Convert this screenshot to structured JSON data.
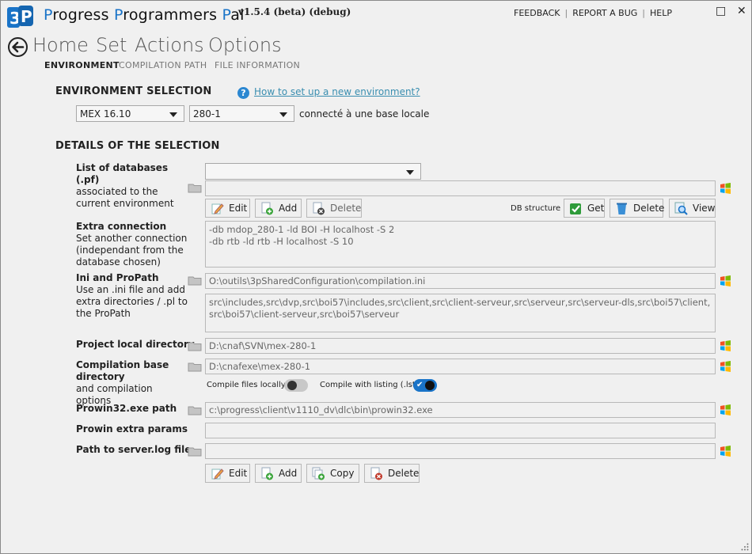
{
  "app": {
    "title_parts": [
      "P",
      "rogress ",
      "P",
      "rogrammers ",
      "P",
      "al"
    ],
    "version": "v1.5.4 (beta) (debug)",
    "links": [
      "FEEDBACK",
      "REPORT A BUG",
      "HELP"
    ],
    "maximize_glyph": "□",
    "close_glyph": "✕"
  },
  "nav": {
    "items": [
      "Home",
      "Set",
      "Actions",
      "Options"
    ],
    "subtabs": [
      "ENVIRONMENT",
      "COMPILATION PATH",
      "FILE INFORMATION"
    ]
  },
  "env": {
    "heading": "ENVIRONMENT SELECTION",
    "help_link": "How to set up a new environment?",
    "env_select": "MEX 16.10",
    "suffix_select": "280-1",
    "status": "connecté à une base locale"
  },
  "details": {
    "heading": "DETAILS OF THE SELECTION",
    "databases": {
      "title": "List of databases (.pf)",
      "desc": "associated to the current environment",
      "select_value": "",
      "path_value": ""
    },
    "db_buttons": [
      "Edit",
      "Add",
      "Delete"
    ],
    "db_structure_label": "DB structure :",
    "db_struct_buttons": [
      "Get",
      "Delete",
      "View"
    ],
    "extra_conn": {
      "title": "Extra connection",
      "desc": "Set another connection (independant from the database chosen)",
      "lines": [
        "-db mdop_280-1 -ld BOI -H localhost -S 2",
        "-db rtb -ld rtb -H localhost -S 10"
      ]
    },
    "ini": {
      "title": "Ini and ProPath",
      "desc": "Use an .ini file and add extra directories / .pl to the ProPath",
      "ini_path": "O:\\outils\\3pSharedConfiguration\\compilation.ini",
      "propath": "src\\includes,src\\dvp,src\\boi57\\includes,src\\client,src\\client-serveur,src\\serveur,src\\serveur-dls,src\\boi57\\client,src\\boi57\\client-serveur,src\\boi57\\serveur"
    },
    "project_dir": {
      "title": "Project local directory",
      "value": "D:\\cnaf\\SVN\\mex-280-1"
    },
    "compile_base": {
      "title": "Compilation base directory",
      "desc": "and compilation options",
      "value": "D:\\cnafexe\\mex-280-1",
      "opt_local": "Compile files locally?",
      "opt_listing": "Compile with listing (.lst)?",
      "local_on": false,
      "listing_on": true
    },
    "prowin": {
      "title": "Prowin32.exe path",
      "value": "c:\\progress\\client\\v1110_dv\\dlc\\bin\\prowin32.exe"
    },
    "prowin_params": {
      "title": "Prowin extra params",
      "value": ""
    },
    "server_log": {
      "title": "Path to server.log file",
      "value": ""
    },
    "env_buttons": [
      "Edit",
      "Add",
      "Copy",
      "Delete"
    ]
  },
  "colors": {
    "accent": "#1a74c8",
    "link": "#3a8eb0",
    "background": "#f0f0f0"
  }
}
